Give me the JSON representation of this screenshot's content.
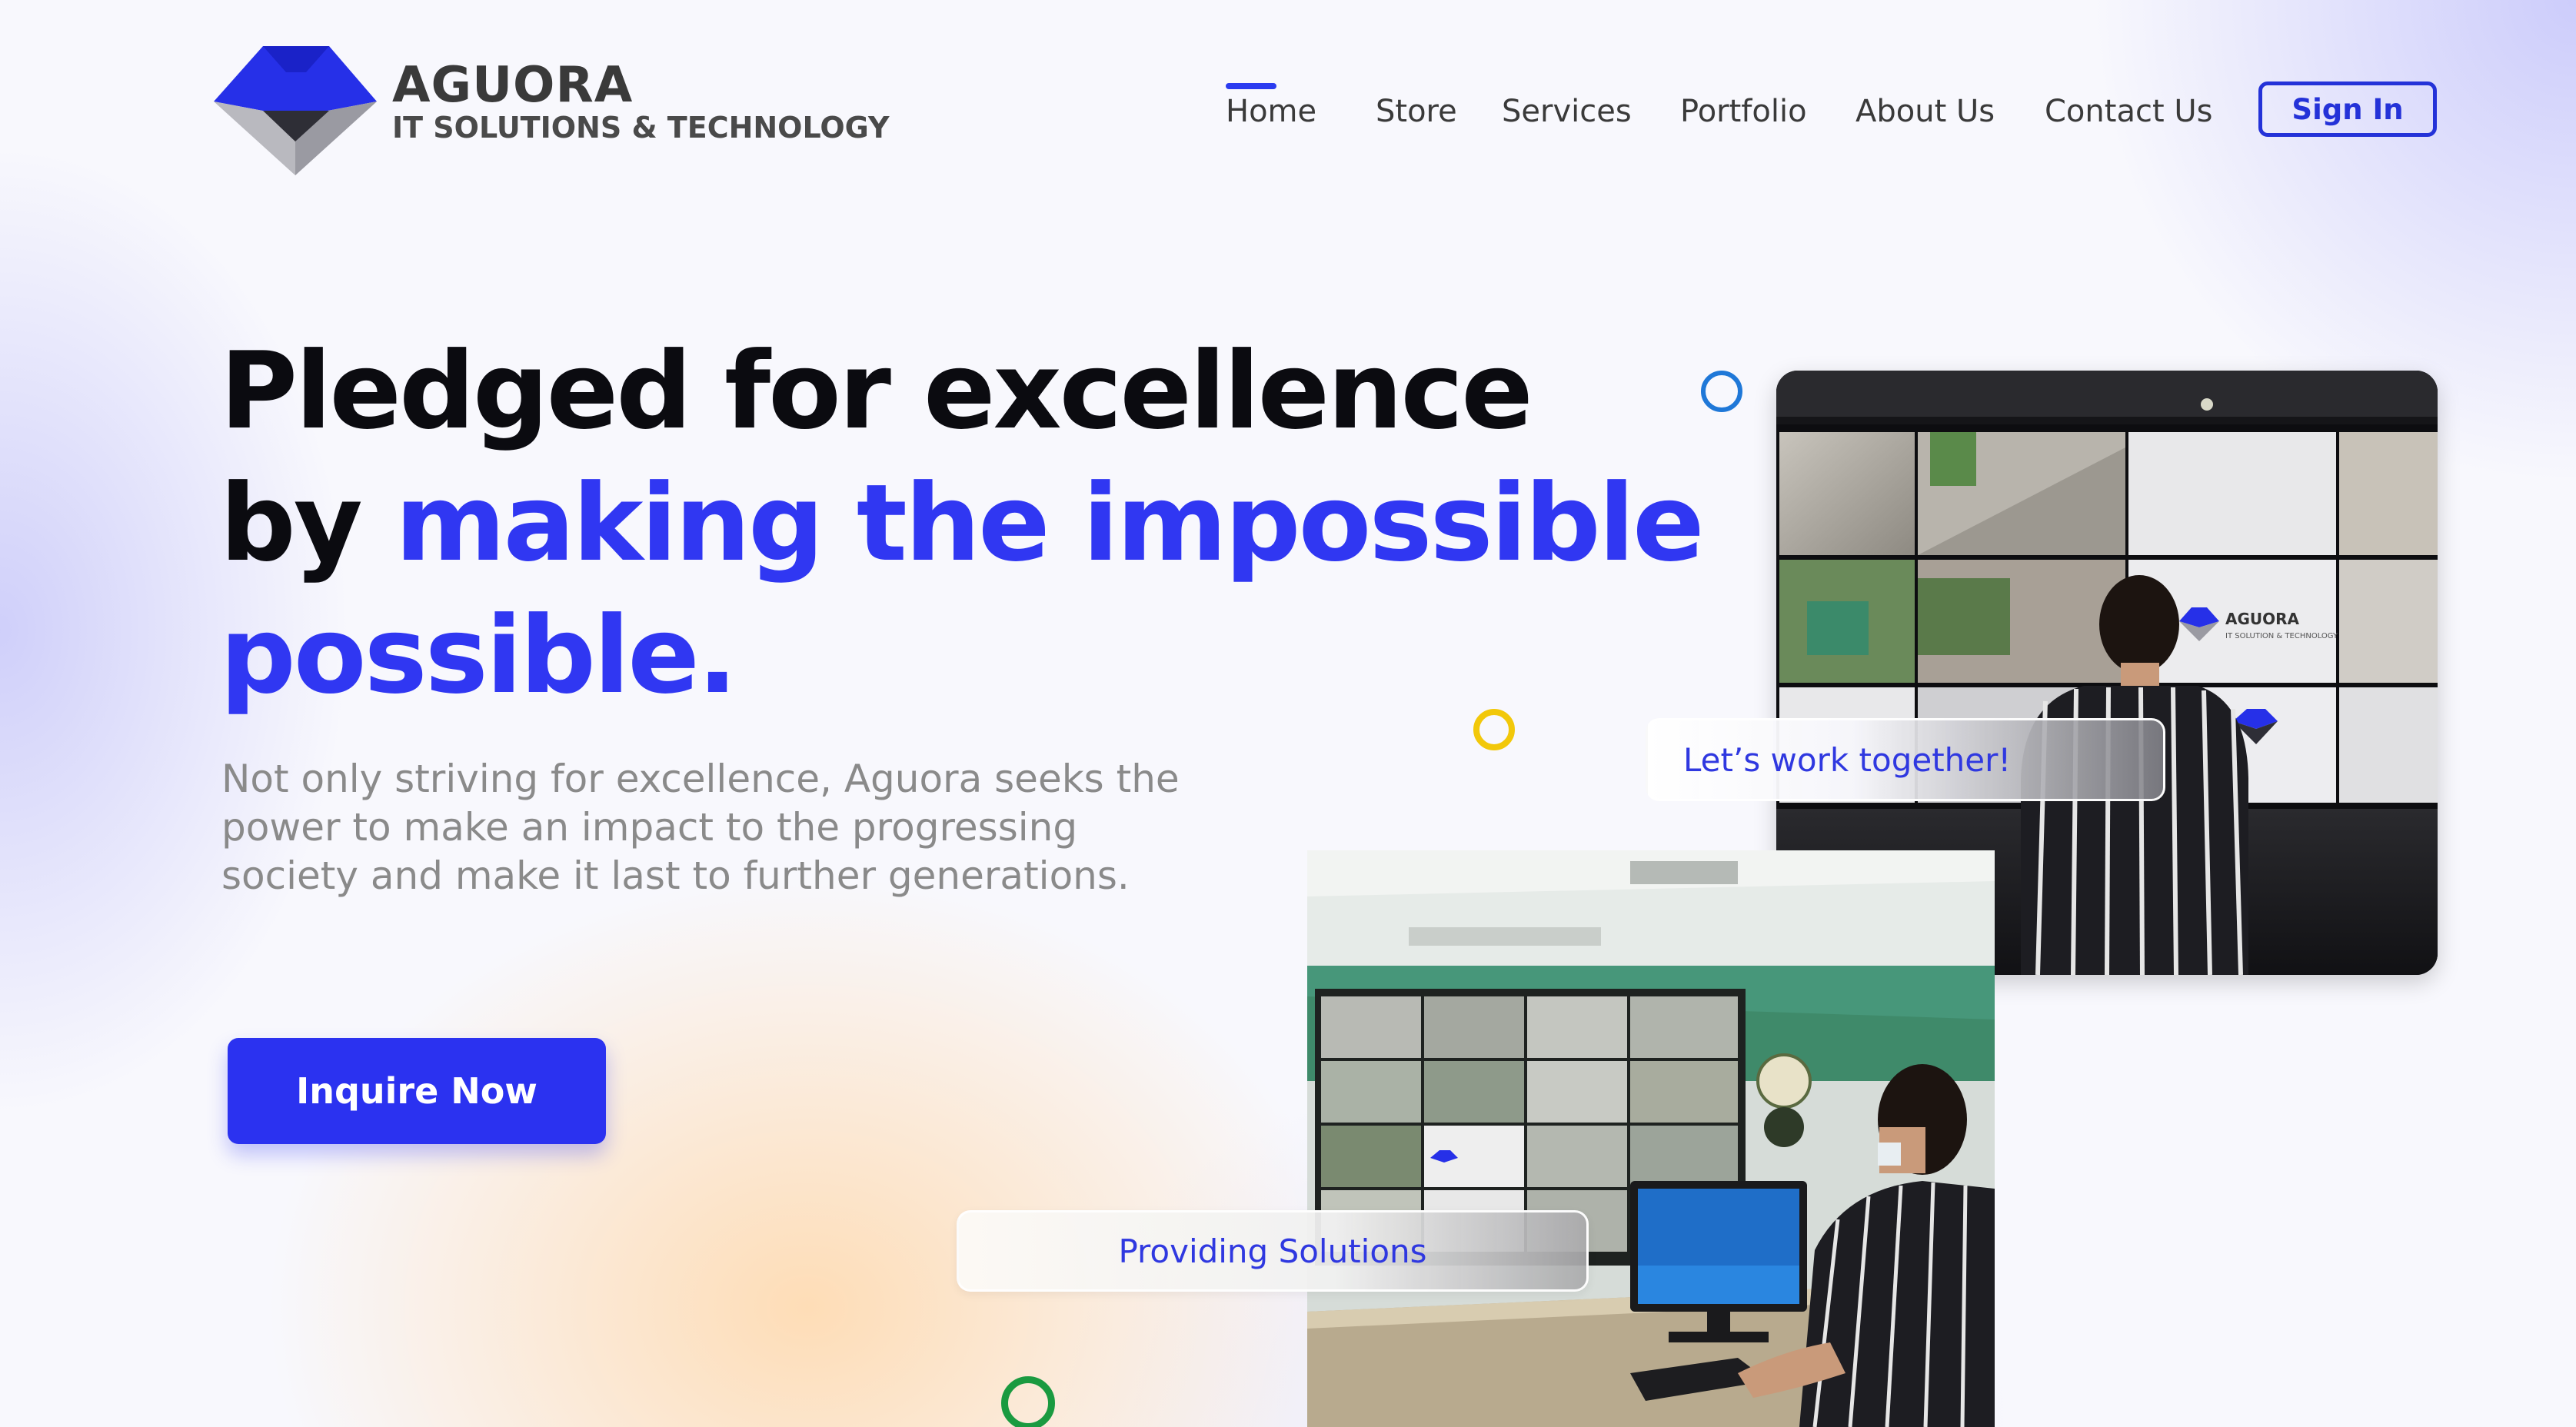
{
  "brand": {
    "name": "AGUORA",
    "tagline": "IT SOLUTIONS & TECHNOLOGY",
    "primary_color": "#2b32f0",
    "text_color": "#0b0b10"
  },
  "nav": {
    "items": [
      {
        "label": "Home",
        "active": true
      },
      {
        "label": "Store",
        "active": false
      },
      {
        "label": "Services",
        "active": false
      },
      {
        "label": "Portfolio",
        "active": false
      },
      {
        "label": "About Us",
        "active": false
      },
      {
        "label": "Contact Us",
        "active": false
      }
    ],
    "sign_in": "Sign In"
  },
  "hero": {
    "line1": "Pledged for excellence",
    "line2_prefix": "by",
    "line2_accent": "making the impossible",
    "line3_accent": "possible.",
    "description": "Not only striving for excellence, Aguora seeks the power to make an impact to the progressing society and make it last to further generations.",
    "cta": "Inquire Now"
  },
  "photos": {
    "top_badge": "Let’s work together!",
    "bottom_badge": "Providing Solutions",
    "wall_logo_name": "AGUORA",
    "wall_logo_sub": "IT SOLUTION & TECHNOLOGY"
  },
  "decor": {
    "ring_colors": [
      "#1f78d8",
      "#f2c80a",
      "#1a9a40"
    ]
  }
}
